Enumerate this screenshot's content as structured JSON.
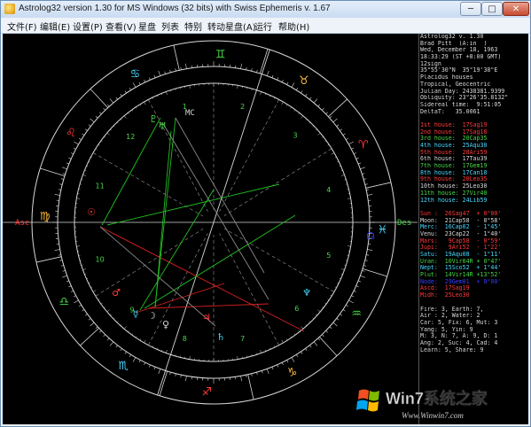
{
  "window": {
    "title": "Astrolog32 version 1.30 for MS Windows (32 bits) with Swiss Ephemeris v. 1.67"
  },
  "titlebar_buttons": {
    "minimize": "─",
    "maximize": "□",
    "close": "✕"
  },
  "menu": [
    "文件(F)",
    "编辑(E)",
    "设置(P)",
    "查看(V)",
    "星盘",
    "列表",
    "特别",
    "转动星盘(A)",
    "运行",
    "帮助(H)"
  ],
  "chart_header": [
    "Astrolog32 v. 1.30",
    "Brad Pitt  (A:in  )",
    "Wed, December 18, 1963",
    "18:33:29 (ST +8:00 GMT)",
    "12sign",
    "35°55'30\"N  35°19'38\"E",
    "Placidus houses",
    "Tropical, Geocentric",
    "Julian Day: 2438381.9399",
    "Obliquity: 23°26'35.8132\"",
    "Sidereal time:  9:51:05",
    "DeltaT:   35.0061"
  ],
  "houses": [
    {
      "text": "1st house:  17Sag19",
      "color": "#ff3a3a"
    },
    {
      "text": "2nd house:  17Sag18",
      "color": "#ff3a3a"
    },
    {
      "text": "3rd house:  20Cap35",
      "color": "#48d848"
    },
    {
      "text": "4th house:  25Aqu30",
      "color": "#48d8ff"
    },
    {
      "text": "5th house:  28Ari59",
      "color": "#ff3a3a"
    },
    {
      "text": "6th house:  17Tau39",
      "color": "#d8d8d8"
    },
    {
      "text": "7th house:  17Gem19",
      "color": "#48d848"
    },
    {
      "text": "8th house:  17Can18",
      "color": "#48d8ff"
    },
    {
      "text": "9th house:  20Leo35",
      "color": "#ff3a3a"
    },
    {
      "text": "10th house: 25Leo30",
      "color": "#d8d8d8"
    },
    {
      "text": "11th house: 27Vir48",
      "color": "#48d848"
    },
    {
      "text": "12th house: 24Lib59",
      "color": "#48d8ff"
    }
  ],
  "planets": [
    {
      "text": "Sun :  26Sag47  + 0°00'",
      "color": "#ff3a3a"
    },
    {
      "text": "Moon:  21Cap58  - 0°58'",
      "color": "#d8d8d8"
    },
    {
      "text": "Merc:  16Cap02  - 1°45'",
      "color": "#48d8ff"
    },
    {
      "text": "Venu:  23Cap22  - 1°40'",
      "color": "#d8d8d8"
    },
    {
      "text": "Mars:   9Cap58  - 0°59'",
      "color": "#ff3a3a"
    },
    {
      "text": "Jupi:   9Ari52  - 1°22'",
      "color": "#ff3a3a"
    },
    {
      "text": "Satu:  19Aqu08  - 1°11'",
      "color": "#48d8ff"
    },
    {
      "text": "Uran:  10Vir04R + 0°47'",
      "color": "#48d848"
    },
    {
      "text": "Nept:  15Sco52  + 1°44'",
      "color": "#48d8ff"
    },
    {
      "text": "Plut:  14Vir14R +13°52'",
      "color": "#48d848"
    },
    {
      "text": "Node:  29Gem01  + 0°00'",
      "color": "#3a3aff"
    },
    {
      "text": "Ascd:  17Sag19",
      "color": "#ff3a3a"
    },
    {
      "text": "Midh:  25Leo30",
      "color": "#ff3a3a"
    }
  ],
  "elements": [
    "Fire: 3, Earth: 7,",
    "Air : 2, Water: 2",
    "Car: 5, Fix: 6, Mut: 3",
    "Yang: 5, Yin: 9",
    "M: 3, N: 7, A: 9, D: 1",
    "Ang: 2, Suc: 4, Cad: 4",
    "Learn: 5, Share: 9"
  ],
  "wheel_labels": {
    "asc": "Asc",
    "desc": "Des",
    "mc": "MC",
    "ic": "IC"
  },
  "house_numbers": [
    "11",
    "12",
    "1",
    "2",
    "3",
    "4",
    "5",
    "6",
    "7",
    "8",
    "9",
    "10"
  ],
  "sign_glyphs": [
    "♑",
    "♒",
    "♓",
    "♈",
    "♉",
    "♊",
    "♋",
    "♌",
    "♍",
    "♎",
    "♏",
    "♐"
  ],
  "planet_glyphs": [
    "☉",
    "☽",
    "☿",
    "♀",
    "♂",
    "♃",
    "♄",
    "♅",
    "♆",
    "♇",
    "☊"
  ],
  "colors": {
    "canvas_bg": "#000000",
    "ring": "#d8d8d8",
    "fire": "#ff3a3a",
    "earth": "#ffbf40",
    "air": "#48d848",
    "water": "#48d8ff",
    "aspect_red": "#d82020",
    "aspect_green": "#20c020"
  },
  "watermark": {
    "brand": "Win7系统之家",
    "url": "Www.Winwin7.com"
  }
}
